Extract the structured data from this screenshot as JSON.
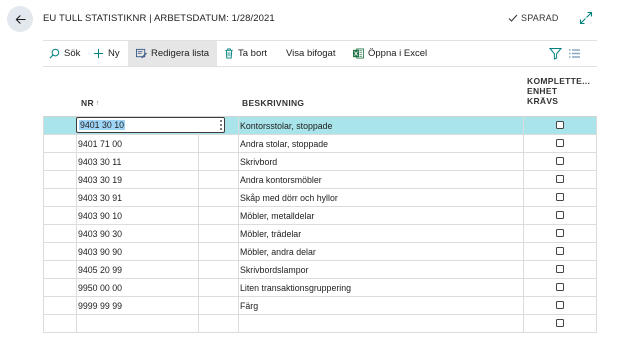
{
  "header": {
    "title": "EU TULL STATISTIKNR | ARBETSDATUM: 1/28/2021",
    "saved_label": "SPARAD"
  },
  "actions": {
    "search": "Sök",
    "new": "Ny",
    "edit_list": "Redigera lista",
    "delete": "Ta bort",
    "show_attached": "Visa bifogat",
    "open_excel": "Öppna i Excel"
  },
  "columns": {
    "nr": "NR",
    "sort_indicator": "↑",
    "description": "BESKRIVNING",
    "complete_unit_line1": "KOMPLETTE...",
    "complete_unit_line2": "ENHET",
    "complete_unit_line3": "KRÄVS"
  },
  "rows": [
    {
      "nr": "9401 30 10",
      "description": "Kontorsstolar, stoppade",
      "required": false
    },
    {
      "nr": "9401 71 00",
      "description": "Andra stolar, stoppade",
      "required": false
    },
    {
      "nr": "9403 30 11",
      "description": "Skrivbord",
      "required": false
    },
    {
      "nr": "9403 30 19",
      "description": "Andra kontorsmöbler",
      "required": false
    },
    {
      "nr": "9403 30 91",
      "description": "Skåp med dörr och hyllor",
      "required": false
    },
    {
      "nr": "9403 90 10",
      "description": "Möbler, metalldelar",
      "required": false
    },
    {
      "nr": "9403 90 30",
      "description": "Möbler, trädelar",
      "required": false
    },
    {
      "nr": "9403 90 90",
      "description": "Möbler, andra delar",
      "required": false
    },
    {
      "nr": "9405 20 99",
      "description": "Skrivbordslampor",
      "required": false
    },
    {
      "nr": "9950 00 00",
      "description": "Liten transaktionsgruppering",
      "required": false
    },
    {
      "nr": "9999 99 99",
      "description": "Färg",
      "required": false
    },
    {
      "nr": "",
      "description": "",
      "required": false
    }
  ],
  "icons": {
    "back": "back-arrow-icon",
    "saved": "checkmark-icon",
    "expand": "expand-icon",
    "search": "search-icon",
    "new": "plus-icon",
    "edit_list": "edit-list-icon",
    "delete": "trash-icon",
    "excel": "excel-icon",
    "filter": "filter-icon",
    "list_view": "list-view-icon"
  },
  "colors": {
    "selected_row": "#a8e4ea",
    "accent": "#00827f",
    "excel": "#217346"
  }
}
